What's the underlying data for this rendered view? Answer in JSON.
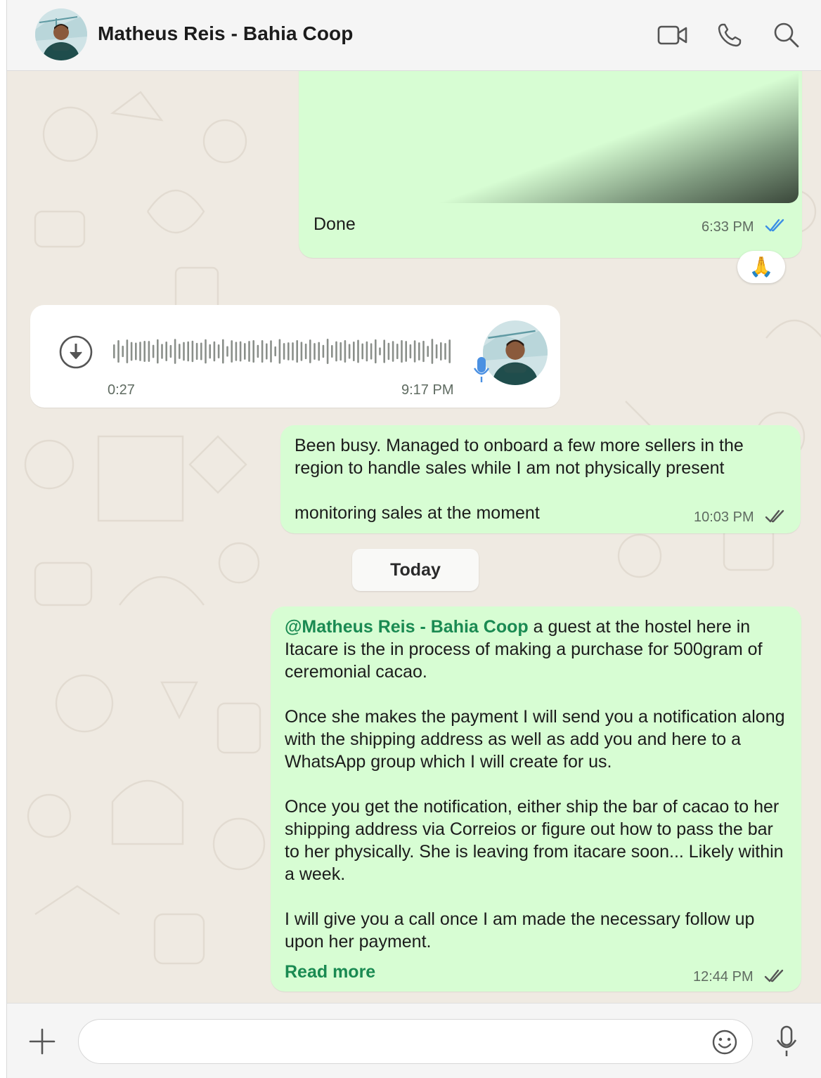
{
  "header": {
    "contact_name": "Matheus Reis - Bahia Coop",
    "icons": [
      "video-call-icon",
      "voice-call-icon",
      "search-icon"
    ]
  },
  "messages": {
    "media_message": {
      "caption": "Done",
      "time": "6:33 PM",
      "status": "read",
      "reaction": "🙏"
    },
    "voice_message": {
      "duration": "0:27",
      "time": "9:17 PM"
    },
    "busy_message": {
      "text": "Been busy. Managed to onboard a few more sellers in the region to handle sales while I am not physically present\n\nmonitoring sales at the moment",
      "time": "10:03 PM",
      "status": "delivered"
    },
    "date_separator": "Today",
    "long_message": {
      "mention": "@Matheus Reis - Bahia Coop",
      "text_after_mention": " a guest at the hostel here in Itacare is the in process of making a purchase for 500gram of ceremonial cacao.\n\nOnce she makes the payment I will send you a notification along with the shipping address as well as add you and here to a WhatsApp group which I will create for us.\n\nOnce you get the notification, either ship the bar of cacao to her shipping address via Correios or figure out how to pass the bar to her physically. She is leaving from itacare soon... Likely within a week.\n\nI will give you a call once I am made the necessary follow up upon her payment.",
      "read_more": "Read more",
      "time": "12:44 PM",
      "status": "delivered"
    }
  },
  "composer": {
    "placeholder": "",
    "icons": [
      "plus-icon",
      "emoji-icon",
      "microphone-icon"
    ]
  },
  "colors": {
    "outgoing_bubble": "#d7fdd3",
    "incoming_bubble": "#ffffff",
    "chat_background": "#efeae2",
    "accent_green": "#1a8a52",
    "read_tick_blue": "#3b8ee5"
  }
}
